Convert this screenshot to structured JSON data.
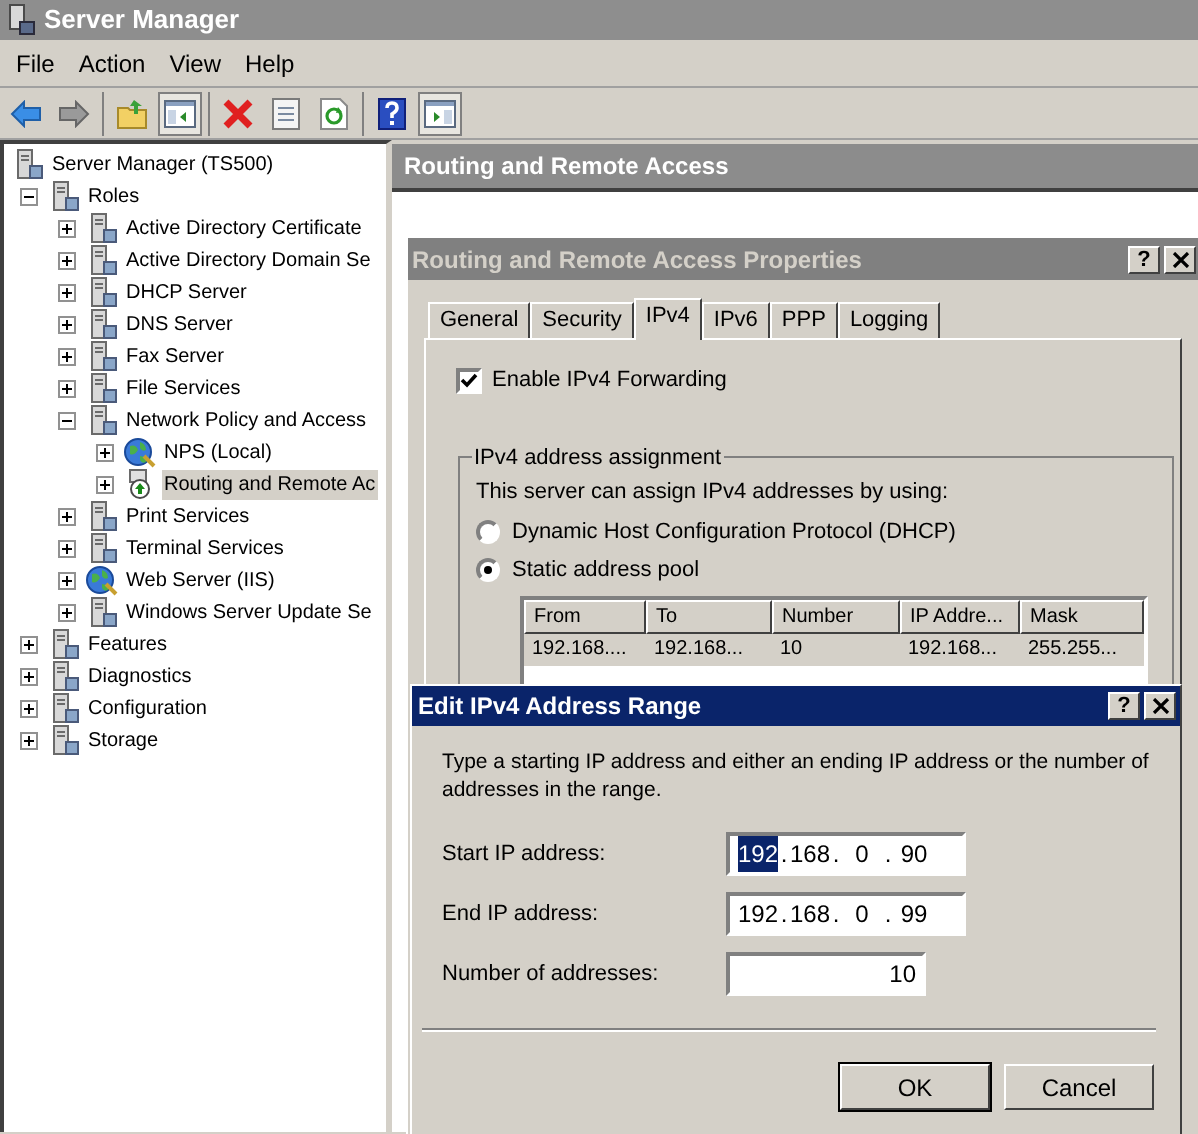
{
  "window": {
    "title": "Server Manager"
  },
  "menu": [
    "File",
    "Action",
    "View",
    "Help"
  ],
  "toolbar": [
    [
      {
        "kind": "back",
        "pressed": false
      },
      {
        "kind": "forward",
        "pressed": false
      }
    ],
    [
      {
        "kind": "up",
        "pressed": false
      },
      {
        "kind": "console_tree",
        "pressed": true
      }
    ],
    [
      {
        "kind": "delete",
        "pressed": false
      },
      {
        "kind": "properties",
        "pressed": false
      },
      {
        "kind": "refresh",
        "pressed": false
      }
    ],
    [
      {
        "kind": "help",
        "pressed": false
      },
      {
        "kind": "action_pane",
        "pressed": true
      }
    ]
  ],
  "tree": [
    {
      "label": "Server Manager (TS500)",
      "kind": "server",
      "selected": false,
      "children": [
        {
          "label": "Roles",
          "kind": "server",
          "expanded": true,
          "selected": false,
          "children": [
            {
              "label": "Active Directory Certificate",
              "kind": "server",
              "expanded": false,
              "selected": false
            },
            {
              "label": "Active Directory Domain Se",
              "kind": "server",
              "expanded": false,
              "selected": false
            },
            {
              "label": "DHCP Server",
              "kind": "server",
              "expanded": false,
              "selected": false
            },
            {
              "label": "DNS Server",
              "kind": "server",
              "expanded": false,
              "selected": false
            },
            {
              "label": "Fax Server",
              "kind": "server",
              "expanded": false,
              "selected": false
            },
            {
              "label": "File Services",
              "kind": "server",
              "expanded": false,
              "selected": false
            },
            {
              "label": "Network Policy and Access",
              "kind": "server",
              "expanded": true,
              "selected": false,
              "children": [
                {
                  "label": "NPS (Local)",
                  "kind": "globe",
                  "expanded": false,
                  "selected": false
                },
                {
                  "label": "Routing and Remote Ac",
                  "kind": "router",
                  "expanded": false,
                  "selected": true
                }
              ]
            },
            {
              "label": "Print Services",
              "kind": "server",
              "expanded": false,
              "selected": false
            },
            {
              "label": "Terminal Services",
              "kind": "server",
              "expanded": false,
              "selected": false
            },
            {
              "label": "Web Server (IIS)",
              "kind": "globe",
              "expanded": false,
              "selected": false
            },
            {
              "label": "Windows Server Update Se",
              "kind": "server",
              "expanded": false,
              "selected": false
            }
          ]
        },
        {
          "label": "Features",
          "kind": "server",
          "expanded": false,
          "selected": false
        },
        {
          "label": "Diagnostics",
          "kind": "server",
          "expanded": false,
          "selected": false
        },
        {
          "label": "Configuration",
          "kind": "server",
          "expanded": false,
          "selected": false
        },
        {
          "label": "Storage",
          "kind": "server",
          "expanded": false,
          "selected": false
        }
      ]
    }
  ],
  "right_panel": {
    "title": "Routing and Remote Access"
  },
  "properties_dialog": {
    "title": "Routing and Remote Access Properties",
    "help_button": "?",
    "tabs": [
      {
        "label": "General",
        "selected": false
      },
      {
        "label": "Security",
        "selected": false
      },
      {
        "label": "IPv4",
        "selected": true
      },
      {
        "label": "IPv6",
        "selected": false
      },
      {
        "label": "PPP",
        "selected": false
      },
      {
        "label": "Logging",
        "selected": false
      }
    ],
    "forwarding": {
      "label": "Enable IPv4 Forwarding",
      "checked": true
    },
    "assignment": {
      "title": "IPv4 address assignment",
      "description": "This server can assign IPv4 addresses by using:",
      "options": [
        {
          "label": "Dynamic Host Configuration Protocol (DHCP)",
          "selected": false
        },
        {
          "label": "Static address pool",
          "selected": true
        }
      ],
      "table": {
        "columns": [
          "From",
          "To",
          "Number",
          "IP Addre...",
          "Mask"
        ],
        "rows": [
          {
            "cells": [
              "192.168....",
              "192.168...",
              "10",
              "192.168...",
              "255.255..."
            ],
            "selected": true
          }
        ]
      }
    }
  },
  "edit_dialog": {
    "title": "Edit IPv4 Address Range",
    "help_button": "?",
    "instructions": "Type a starting IP address and either an ending IP address or the number of addresses in the range.",
    "octet_separator": ".",
    "fields": [
      {
        "label": "Start IP address:",
        "kind": "ip",
        "octets": [
          {
            "text": "192",
            "selected": true
          },
          {
            "text": "168",
            "selected": false
          },
          {
            "text": "0",
            "selected": false
          },
          {
            "text": "90",
            "selected": false
          }
        ]
      },
      {
        "label": "End IP address:",
        "kind": "ip",
        "octets": [
          {
            "text": "192",
            "selected": false
          },
          {
            "text": "168",
            "selected": false
          },
          {
            "text": "0",
            "selected": false
          },
          {
            "text": "99",
            "selected": false
          }
        ]
      },
      {
        "label": "Number of addresses:",
        "kind": "number",
        "value": "10"
      }
    ],
    "buttons": [
      {
        "label": "OK",
        "default": true
      },
      {
        "label": "Cancel",
        "default": false
      }
    ]
  }
}
